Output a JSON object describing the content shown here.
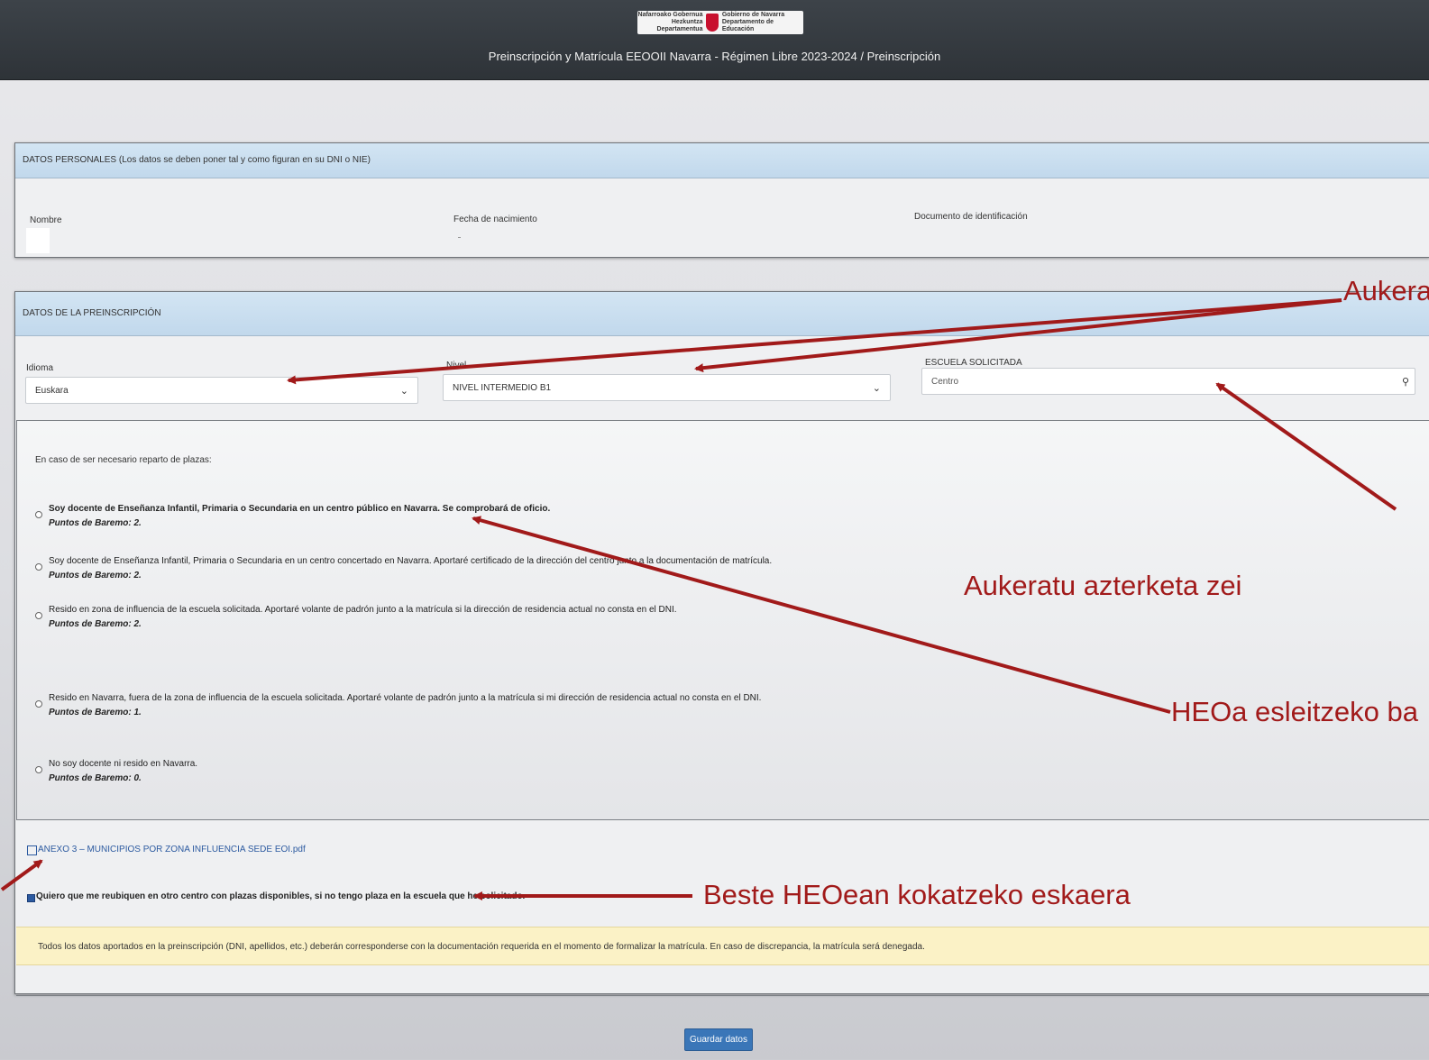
{
  "header": {
    "logo": {
      "left_line1": "Nafarroako Gobernua",
      "left_line2": "Hezkuntza Departamentua",
      "right_line1": "Gobierno de Navarra",
      "right_line2": "Departamento de Educación"
    },
    "title": "Preinscripción y Matrícula EEOOII Navarra - Régimen Libre 2023-2024 / Preinscripción"
  },
  "personal": {
    "heading": "DATOS PERSONALES (Los datos se deben poner tal y como figuran en su DNI o NIE)",
    "name_label": "Nombre",
    "birth_label": "Fecha de nacimiento",
    "doc_label": "Documento de identificación"
  },
  "prescription": {
    "heading": "DATOS DE LA PREINSCRIPCIÓN",
    "language_label": "Idioma",
    "language_value": "Euskara",
    "level_label": "Nivel",
    "level_value": "NIVEL INTERMEDIO B1",
    "school_label": "ESCUELA SOLICITADA",
    "school_placeholder": "Centro"
  },
  "reparto": {
    "intro": "En caso de ser necesario reparto de plazas:",
    "options": [
      {
        "text": "Soy docente de Enseñanza Infantil, Primaria o Secundaria en un centro público en Navarra. Se comprobará de oficio.",
        "points": "Puntos de Baremo: 2."
      },
      {
        "text": "Soy docente de Enseñanza Infantil, Primaria o Secundaria en un centro concertado en Navarra. Aportaré certificado de la dirección del centro junto a la documentación de matrícula.",
        "points": "Puntos de Baremo: 2."
      },
      {
        "text": "Resido en zona de influencia de la escuela solicitada. Aportaré volante de padrón junto a la matrícula si la dirección de residencia actual no consta en el DNI.",
        "points": "Puntos de Baremo: 2."
      },
      {
        "text": "Resido en Navarra, fuera de la zona de influencia de la escuela solicitada. Aportaré volante de padrón junto a la matrícula si mi dirección de residencia actual no consta en el DNI.",
        "points": "Puntos de Baremo: 1."
      },
      {
        "text": "No soy docente ni resido en Navarra.",
        "points": "Puntos de Baremo: 0."
      }
    ]
  },
  "attachment": {
    "label": "ANEXO 3 – MUNICIPIOS POR ZONA INFLUENCIA SEDE EOI.pdf"
  },
  "relocate": {
    "label": "Quiero que me reubiquen en otro centro con plazas disponibles, si no tengo plaza en la escuela que he solicitado.",
    "checked": true
  },
  "notice": "Todos los datos aportados en la preinscripción (DNI, apellidos, etc.) deberán corresponderse con la documentación requerida en el momento de formalizar la matrícula. En caso de discrepancia, la matrícula será denegada.",
  "save_button": "Guardar datos",
  "annotations": {
    "aukera": "Aukera",
    "azterketa": "Aukeratu azterketa zei",
    "heoa": "HEOa esleitzeko ba",
    "beste": "Beste HEOean kokatzeko eskaera"
  },
  "colors": {
    "annotation": "#a11a1a",
    "accent": "#3a76b8",
    "header_bg": "#3d4349",
    "panel_head": "#c8ddef",
    "notice_bg": "#fbf2c6"
  }
}
